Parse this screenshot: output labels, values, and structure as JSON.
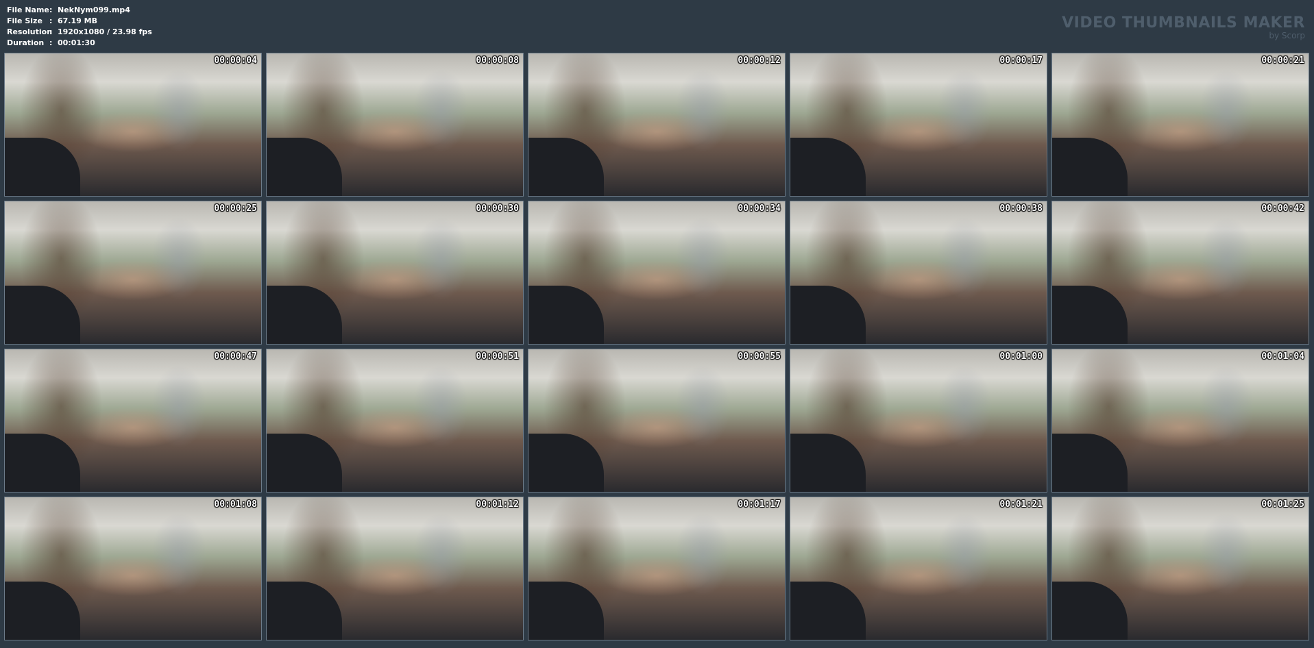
{
  "file_info": {
    "rows": [
      {
        "key": "File Name",
        "value": "NekNym099.mp4"
      },
      {
        "key": "File Size",
        "value": "67.19 MB"
      },
      {
        "key": "Resolution",
        "value": "1920x1080 / 23.98 fps"
      },
      {
        "key": "Duration",
        "value": "00:01:30"
      }
    ],
    "separator": ":"
  },
  "brand": {
    "title": "VIDEO THUMBNAILS MAKER",
    "subtitle": "by Scorp"
  },
  "thumbnails": [
    {
      "timestamp": "00:00:04"
    },
    {
      "timestamp": "00:00:08"
    },
    {
      "timestamp": "00:00:12"
    },
    {
      "timestamp": "00:00:17"
    },
    {
      "timestamp": "00:00:21"
    },
    {
      "timestamp": "00:00:25"
    },
    {
      "timestamp": "00:00:30"
    },
    {
      "timestamp": "00:00:34"
    },
    {
      "timestamp": "00:00:38"
    },
    {
      "timestamp": "00:00:42"
    },
    {
      "timestamp": "00:00:47"
    },
    {
      "timestamp": "00:00:51"
    },
    {
      "timestamp": "00:00:55"
    },
    {
      "timestamp": "00:01:00"
    },
    {
      "timestamp": "00:01:04"
    },
    {
      "timestamp": "00:01:08"
    },
    {
      "timestamp": "00:01:12"
    },
    {
      "timestamp": "00:01:17"
    },
    {
      "timestamp": "00:01:21"
    },
    {
      "timestamp": "00:01:25"
    }
  ]
}
